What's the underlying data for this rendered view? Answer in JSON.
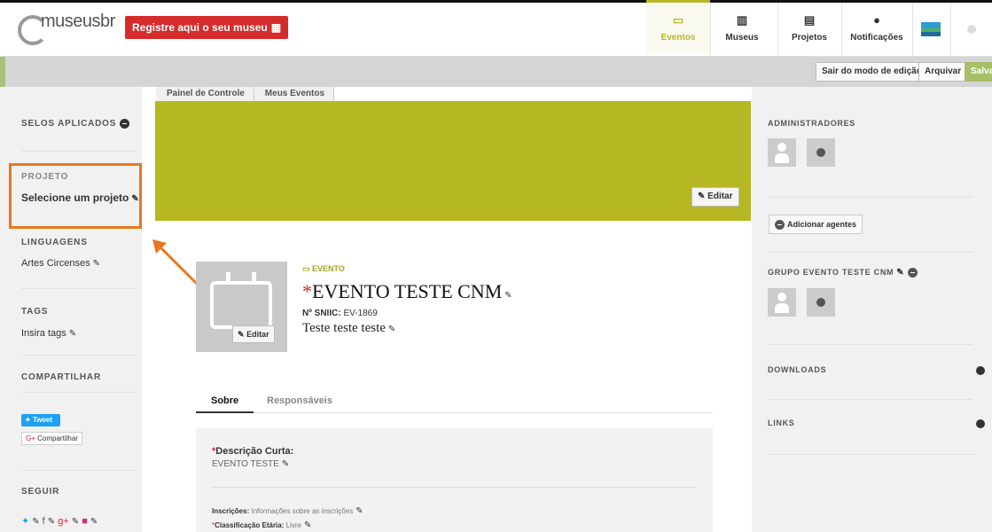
{
  "header": {
    "logo_text": "museusbr",
    "register_button": "Registre aqui o seu museu",
    "nav": [
      {
        "label": "Eventos",
        "icon": "calendar-icon"
      },
      {
        "label": "Museus",
        "icon": "museum-icon"
      },
      {
        "label": "Projetos",
        "icon": "document-icon"
      },
      {
        "label": "Notificações",
        "icon": "chat-bubble-icon"
      }
    ]
  },
  "edit_bar": {
    "exit_edit": "Sair do modo de edição",
    "archive": "Arquivar",
    "save": "Salvar"
  },
  "left_sidebar": {
    "seals_heading": "SELOS APLICADOS",
    "project_heading": "PROJETO",
    "project_value": "Selecione um projeto",
    "languages_heading": "LINGUAGENS",
    "languages_value": "Artes Circenses",
    "tags_heading": "TAGS",
    "tags_value": "Insira tags",
    "share_heading": "COMPARTILHAR",
    "tweet_label": "Tweet",
    "gplus_share_label": "Compartilhar",
    "follow_heading": "SEGUIR"
  },
  "breadcrumb": [
    "Painel de Controle",
    "Meus Eventos"
  ],
  "cover": {
    "edit_label": "Editar"
  },
  "entity": {
    "type_label": "EVENTO",
    "title_asterisk": "*",
    "title": "EVENTO TESTE CNM",
    "sniic_label": "Nº SNIIC:",
    "sniic_value": "EV-1869",
    "subtitle": "Teste teste teste",
    "avatar_edit_label": "Editar"
  },
  "tabs": [
    "Sobre",
    "Responsáveis"
  ],
  "about": {
    "short_desc_asterisk": "*",
    "short_desc_label": "Descrição Curta:",
    "short_desc_value": "EVENTO TESTE",
    "registrations_label": "Inscrições:",
    "registrations_value": "Informações sobre as inscrições",
    "rating_asterisk": "*",
    "rating_label": "Classificação Etária:",
    "rating_value": "Livre"
  },
  "right_sidebar": {
    "admins_heading": "ADMINISTRADORES",
    "add_agents_label": "Adicionar agentes",
    "group_heading": "GRUPO EVENTO TESTE CNM",
    "downloads_heading": "DOWNLOADS",
    "links_heading": "LINKS"
  },
  "colors": {
    "accent": "#b5b822",
    "register_red": "#d52b2b",
    "highlight_orange": "#e8781c",
    "save_green": "#a7bf6a"
  }
}
